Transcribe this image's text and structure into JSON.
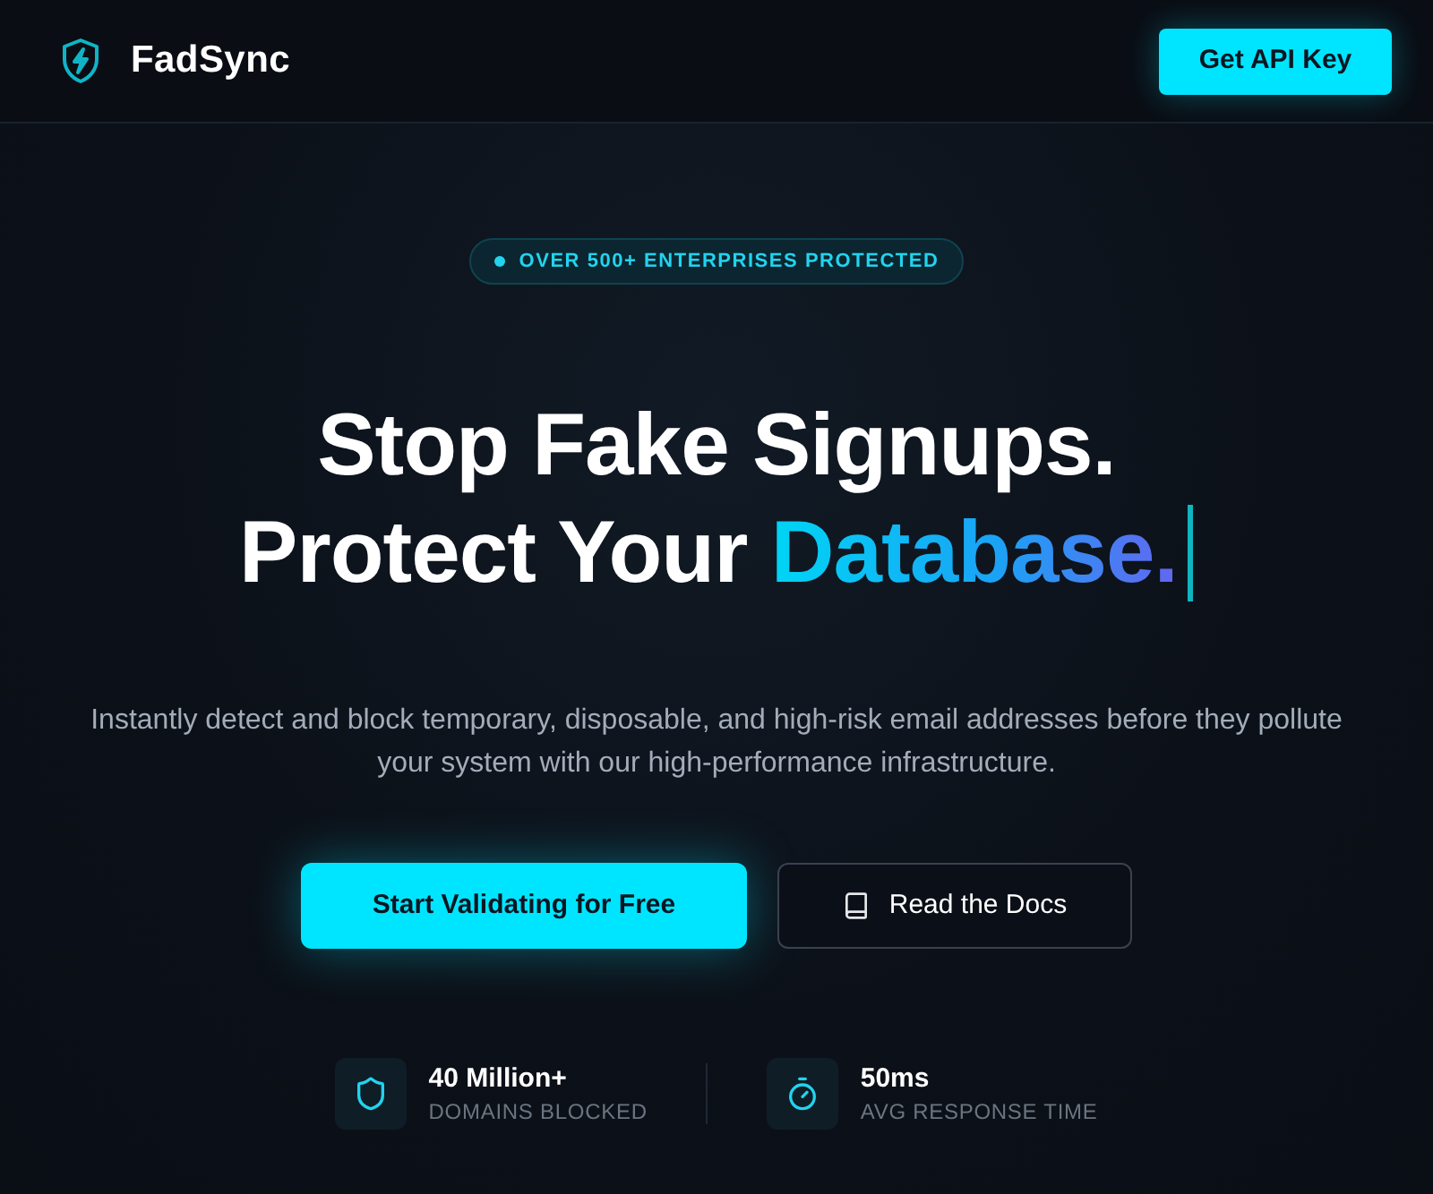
{
  "header": {
    "brand": "FadSync",
    "cta": "Get API Key"
  },
  "hero": {
    "badge": "OVER 500+ ENTERPRISES PROTECTED",
    "headline": {
      "line_1": "Stop Fake Signups.",
      "line_2": "Protect Your",
      "highlight": "Database."
    },
    "subtitle": "Instantly detect and block temporary, disposable, and high-risk email addresses before they pollute your system with our high-performance infrastructure.",
    "buttons": [
      {
        "label": "Start Validating for Free",
        "kind": "primary"
      },
      {
        "label": "Read the Docs",
        "kind": "docs"
      }
    ]
  },
  "stats": [
    {
      "kind": "shield",
      "value": "40 Million+",
      "label": "DOMAINS BLOCKED"
    },
    {
      "kind": "timer",
      "value": "50ms",
      "label": "AVG RESPONSE TIME"
    }
  ]
}
